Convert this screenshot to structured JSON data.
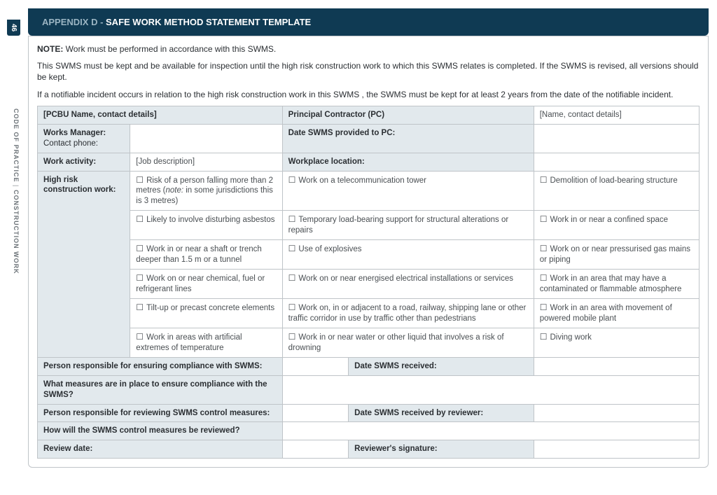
{
  "page_number": "46",
  "sidebar": {
    "line1": "CODE OF PRACTICE",
    "sep": "|",
    "line2": "CONSTRUCTION WORK"
  },
  "header": {
    "prefix": "APPENDIX D - ",
    "title": "SAFE WORK METHOD STATEMENT TEMPLATE"
  },
  "notes": {
    "n1_bold": "NOTE:",
    "n1_rest": " Work must be performed in accordance with this SWMS.",
    "n2": "This SWMS must be kept and be available for inspection until the high risk construction work to which this SWMS relates is completed.  If the SWMS is revised, all versions should be kept.",
    "n3": "If a notifiable incident occurs in relation to the high risk construction work in this SWMS , the SWMS must be kept for at least 2 years from the date of the notifiable incident."
  },
  "row1": {
    "pcbu": "[PCBU Name, contact details]",
    "pc_label": "Principal Contractor (PC)",
    "pc_value": "[Name, contact details]"
  },
  "row2": {
    "wm_label": "Works Manager:",
    "wm_sub": "Contact phone:",
    "date_pc": "Date SWMS provided to PC:"
  },
  "row3": {
    "activity_label": "Work activity:",
    "activity_value": "[Job description]",
    "location_label": "Workplace location:"
  },
  "hr": {
    "label": "High risk construction work:",
    "rows": [
      {
        "c1_pre": "Risk of a person falling more than 2 metres (",
        "c1_ital": "note:",
        "c1_post": " in some jurisdictions this is 3 metres)",
        "c2": "Work on a telecommunication tower",
        "c3": "Demolition of load-bearing structure"
      },
      {
        "c1": "Likely to involve disturbing asbestos",
        "c2": "Temporary load-bearing support for structural alterations or repairs",
        "c3": "Work in or near a confined space"
      },
      {
        "c1": "Work in or near a shaft or trench deeper than 1.5 m or a tunnel",
        "c2": "Use of explosives",
        "c3": "Work on or near pressurised gas mains or piping"
      },
      {
        "c1": "Work on or near chemical, fuel or refrigerant lines",
        "c2": "Work on or near energised electrical installations or services",
        "c3": "Work in an area that may have a contaminated or flammable atmosphere"
      },
      {
        "c1": "Tilt-up or precast concrete elements",
        "c2": "Work on, in or adjacent to a road, railway, shipping lane or other traffic corridor in use by traffic other than pedestrians",
        "c3": "Work in an area with movement of powered mobile plant"
      },
      {
        "c1": "Work in areas with artificial extremes of temperature",
        "c2": "Work in or near water or other liquid that involves a risk of drowning",
        "c3": "Diving work"
      }
    ]
  },
  "row_person_comp": {
    "label": "Person responsible for ensuring compliance with SWMS:",
    "date": "Date SWMS received:"
  },
  "row_measures": {
    "label": "What measures are in place to ensure compliance with the SWMS?"
  },
  "row_reviewer": {
    "label": "Person responsible for reviewing SWMS control measures:",
    "date": "Date SWMS received by reviewer:"
  },
  "row_how_review": {
    "label": "How will the SWMS control measures be reviewed?"
  },
  "row_review_date": {
    "label": "Review date:",
    "sig": "Reviewer's signature:"
  }
}
